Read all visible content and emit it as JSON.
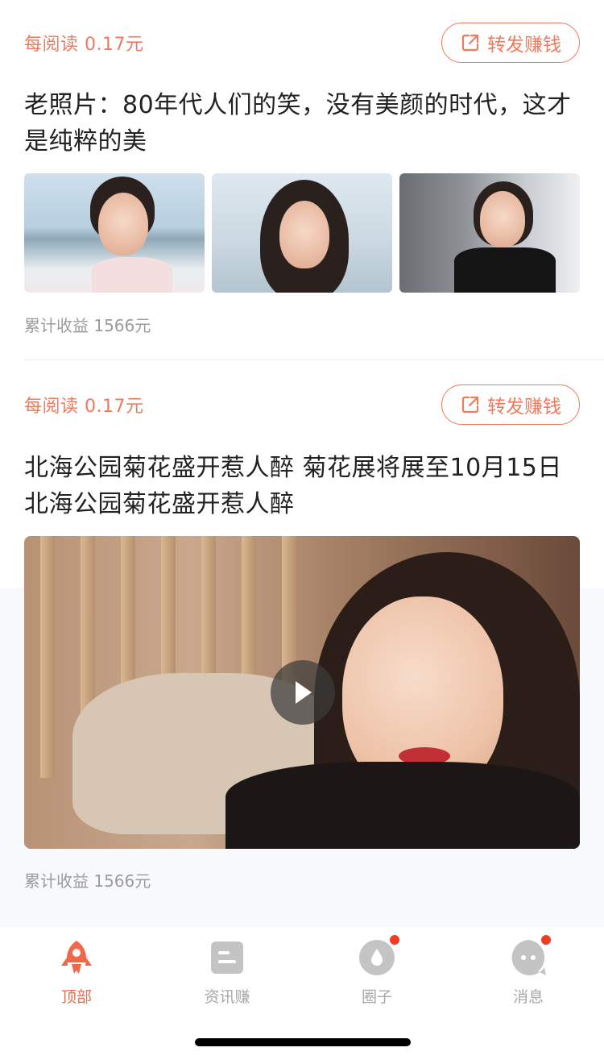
{
  "feed": [
    {
      "per_read": "每阅读 0.17元",
      "share_label": "转发赚钱",
      "title": "老照片：80年代人们的笑，没有美颜的时代，这才是纯粹的美",
      "media_type": "images",
      "earnings": "累计收益 1566元"
    },
    {
      "per_read": "每阅读 0.17元",
      "share_label": "转发赚钱",
      "title": "北海公园菊花盛开惹人醉 菊花展将展至10月15日北海公园菊花盛开惹人醉",
      "media_type": "video",
      "earnings": "累计收益 1566元"
    }
  ],
  "tabbar": {
    "items": [
      {
        "label": "顶部",
        "icon": "rocket-icon",
        "active": true,
        "badge": false
      },
      {
        "label": "资讯赚",
        "icon": "news-icon",
        "active": false,
        "badge": false
      },
      {
        "label": "圈子",
        "icon": "circle-drop-icon",
        "active": false,
        "badge": true
      },
      {
        "label": "消息",
        "icon": "chat-bubble-icon",
        "active": false,
        "badge": true
      }
    ]
  },
  "colors": {
    "accent": "#f07a5d",
    "active_tab": "#f0684a",
    "badge": "#f23b1f",
    "muted_text": "#9b9b9b"
  }
}
